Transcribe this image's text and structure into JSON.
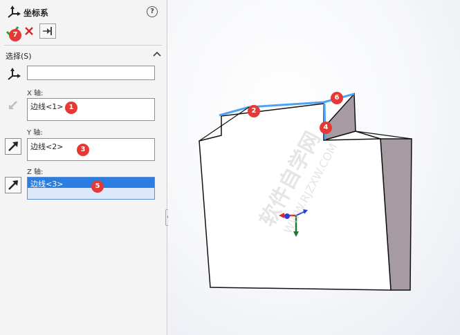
{
  "panel": {
    "title": "坐标系",
    "help_glyph": "?",
    "section_title": "选择(S)",
    "origin_value": "",
    "x_axis": {
      "label": "X 轴:",
      "value": "边线<1>"
    },
    "y_axis": {
      "label": "Y 轴:",
      "value": "边线<2>"
    },
    "z_axis": {
      "label": "Z 轴:",
      "value": "边线<3>"
    }
  },
  "badges": [
    "1",
    "2",
    "3",
    "4",
    "5",
    "6",
    "7"
  ],
  "colors": {
    "accept": "#2e9e3a",
    "cancel": "#d62828",
    "badge": "#e53935",
    "edge_highlight": "#4da3f0",
    "face_side": "#a69aa3",
    "selection": "#2a7de1"
  },
  "icons": [
    "coordinate-system-icon",
    "help-icon",
    "accept-check-icon",
    "cancel-x-icon",
    "pin-icon",
    "chevron-up-icon",
    "reverse-direction-icon",
    "triad-icon"
  ]
}
